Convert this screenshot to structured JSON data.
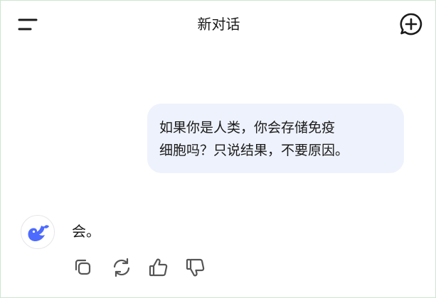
{
  "header": {
    "title": "新对话",
    "menu_icon": "menu-icon",
    "new_chat_icon": "new-chat-icon"
  },
  "messages": [
    {
      "role": "user",
      "lines": [
        "如果你是人类，你会存储免疫",
        "细胞吗？只说结果，不要原因。"
      ]
    },
    {
      "role": "assistant",
      "avatar_icon": "whale-logo-icon",
      "text": "会。"
    }
  ],
  "actions": {
    "copy_icon": "copy-icon",
    "regenerate_icon": "regenerate-icon",
    "like_icon": "thumbs-up-icon",
    "dislike_icon": "thumbs-down-icon"
  },
  "colors": {
    "bubble_background": "#eef2fc",
    "brand_blue": "#4d6bfe",
    "icon_gray": "#555555",
    "frame_border": "#cfe6cf"
  }
}
